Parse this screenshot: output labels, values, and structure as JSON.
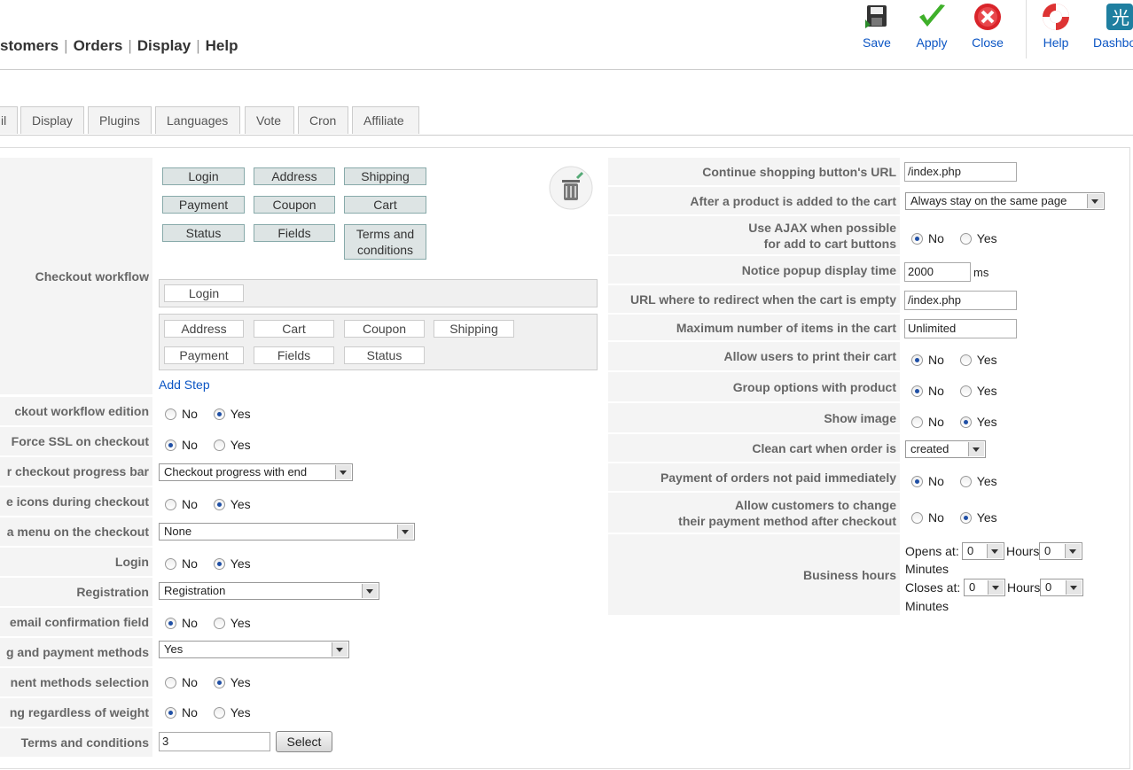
{
  "menu": {
    "items": [
      "stomers",
      "Orders",
      "Display",
      "Help"
    ]
  },
  "toolbar": {
    "save": "Save",
    "apply": "Apply",
    "close": "Close",
    "help": "Help",
    "dashboard": "Dashbo"
  },
  "tabs": [
    "il",
    "Display",
    "Plugins",
    "Languages",
    "Vote",
    "Cron",
    "Affiliate"
  ],
  "left": {
    "checkout_workflow_label": "Checkout workflow",
    "available_steps": [
      "Login",
      "Address",
      "Shipping",
      "Payment",
      "Coupon",
      "Cart",
      "Status",
      "Fields",
      "Terms and conditions"
    ],
    "step1": [
      "Login"
    ],
    "step2": [
      "Address",
      "Cart",
      "Coupon",
      "Shipping",
      "Payment",
      "Fields",
      "Status"
    ],
    "add_step": "Add Step",
    "rows": [
      {
        "label": "ckout workflow edition",
        "type": "radio",
        "value": "Yes"
      },
      {
        "label": "Force SSL on checkout",
        "type": "radio",
        "value": "No"
      },
      {
        "label": "r checkout progress bar",
        "type": "select",
        "value": "Checkout progress with end"
      },
      {
        "label": "e icons during checkout",
        "type": "radio",
        "value": "Yes"
      },
      {
        "label": "a menu on the checkout",
        "type": "select",
        "value": "None"
      },
      {
        "label": "Login",
        "type": "radio",
        "value": "Yes"
      },
      {
        "label": "Registration",
        "type": "select",
        "value": "Registration"
      },
      {
        "label": "email confirmation field",
        "type": "radio",
        "value": "No"
      },
      {
        "label": "g and payment methods",
        "type": "select",
        "value": "Yes"
      },
      {
        "label": "nent methods selection",
        "type": "radio",
        "value": "Yes"
      },
      {
        "label": "ng regardless of weight",
        "type": "radio",
        "value": "No"
      },
      {
        "label": "Terms and conditions",
        "type": "input",
        "value": "3",
        "button": "Select"
      }
    ]
  },
  "radio_options": {
    "no": "No",
    "yes": "Yes"
  },
  "right": {
    "rows": [
      {
        "label": "Continue shopping button's URL",
        "type": "input",
        "value": "/index.php"
      },
      {
        "label": "After a product is added to the cart",
        "type": "select",
        "value": "Always stay on the same page"
      },
      {
        "label": "Use AJAX when possible",
        "label2": "for add to cart buttons",
        "type": "radio",
        "value": "No"
      },
      {
        "label": "Notice popup display time",
        "type": "input",
        "value": "2000",
        "unit": "ms"
      },
      {
        "label": "URL where to redirect when the cart is empty",
        "type": "input",
        "value": "/index.php"
      },
      {
        "label": "Maximum number of items in the cart",
        "type": "input",
        "value": "Unlimited"
      },
      {
        "label": "Allow users to print their cart",
        "type": "radio",
        "value": "No"
      },
      {
        "label": "Group options with product",
        "type": "radio",
        "value": "No"
      },
      {
        "label": "Show image",
        "type": "radio",
        "value": "Yes"
      },
      {
        "label": "Clean cart when order is",
        "type": "select",
        "value": "created"
      },
      {
        "label": "Payment of orders not paid immediately",
        "type": "radio",
        "value": "No"
      },
      {
        "label": "Allow customers to change",
        "label2": "their payment method after checkout",
        "type": "radio",
        "value": "Yes"
      },
      {
        "label": "Business hours",
        "type": "hours"
      }
    ],
    "business_hours": {
      "opens_label": "Opens at:",
      "closes_label": "Closes at:",
      "hours_label": "Hours",
      "minutes_label": "Minutes",
      "opens_hours": "0",
      "opens_minutes": "0",
      "closes_hours": "0",
      "closes_minutes": "0"
    }
  }
}
